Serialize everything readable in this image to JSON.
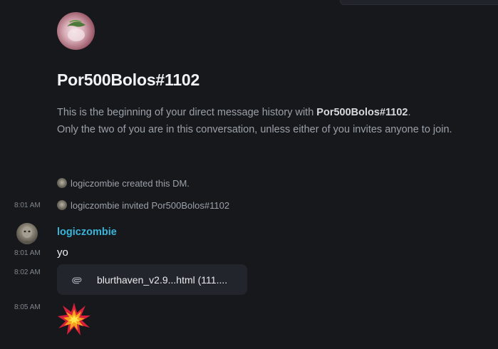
{
  "header": {
    "title": "Por500Bolos#1102",
    "intro_prefix": "This is the beginning of your direct message history with ",
    "intro_name": "Por500Bolos#1102",
    "intro_suffix": ".",
    "intro_line2": "Only the two of you are in this conversation, unless either of you invites anyone to join."
  },
  "system_events": [
    {
      "time": "",
      "text": "logiczombie created this DM."
    },
    {
      "time": "8:01 AM",
      "text": "logiczombie invited Por500Bolos#1102"
    }
  ],
  "messages": {
    "author": "logiczombie",
    "author_color": "#3ab5da",
    "items": [
      {
        "time": "8:01 AM",
        "text": "yo"
      },
      {
        "time": "8:02 AM",
        "attachment": {
          "icon": "paperclip-icon",
          "filename": "blurthaven_v2.9...html (111...."
        }
      },
      {
        "time": "8:05 AM",
        "emoji": "collision-emoji"
      }
    ]
  }
}
